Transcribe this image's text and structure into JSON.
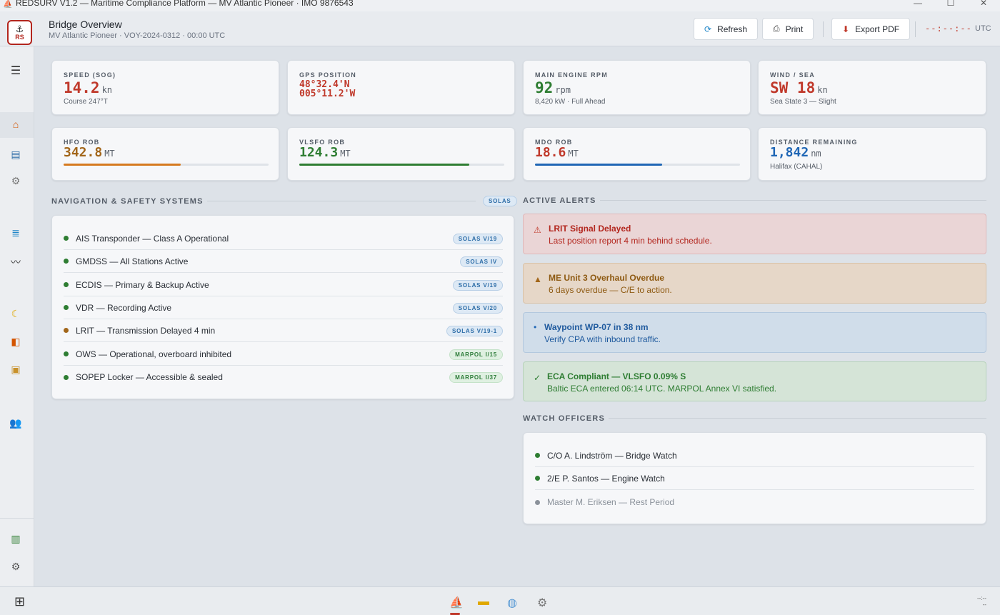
{
  "window": {
    "title": "REDSURV V1.2 — Maritime Compliance Platform — MV Atlantic Pioneer · IMO 9876543",
    "controls": [
      "—",
      "☐",
      "✕"
    ]
  },
  "header": {
    "logo_text": "RS",
    "title": "Bridge Overview",
    "subtitle": "MV Atlantic Pioneer · VOY-2024-0312 · 00:00 UTC",
    "buttons": {
      "refresh": "Refresh",
      "print": "Print",
      "export": "Export PDF"
    },
    "clock": "--:--:--",
    "timezone": "UTC"
  },
  "sidebar": {
    "icons": [
      "menu-icon",
      "home-icon",
      "book-icon",
      "settings-gear-icon",
      "database-icon",
      "wave-icon",
      "moon-icon",
      "life-vest-icon",
      "package-icon",
      "users-icon",
      "chart-icon",
      "gear-icon"
    ]
  },
  "stats": [
    {
      "label": "SPEED (SOG)",
      "value": "14.2",
      "unit": "kn",
      "sub": "Course 247°T",
      "color": "#c0392b"
    },
    {
      "label": "GPS POSITION",
      "lat": "48°32.4'N",
      "lon": "005°11.2'W",
      "color": "#c0392b"
    },
    {
      "label": "MAIN ENGINE RPM",
      "value": "92",
      "unit": "rpm",
      "sub": "8,420 kW · Full Ahead",
      "color": "#2e7d32"
    },
    {
      "label": "WIND / SEA",
      "value": "SW 18",
      "unit": "kn",
      "sub": "Sea State 3 — Slight",
      "color": "#c0392b"
    }
  ],
  "fuel": [
    {
      "label": "HFO ROB",
      "value": "342.8",
      "unit": "MT",
      "level": 0.57,
      "color": "#d67a1f",
      "text_color": "#a2661a"
    },
    {
      "label": "VLSFO ROB",
      "value": "124.3",
      "unit": "MT",
      "level": 0.83,
      "color": "#2e7d32",
      "text_color": "#2e7d32"
    },
    {
      "label": "MDO ROB",
      "value": "18.6",
      "unit": "MT",
      "level": 0.62,
      "color": "#1f66b5",
      "text_color": "#c0392b"
    },
    {
      "label": "DISTANCE REMAINING",
      "value": "1,842",
      "unit": "nm",
      "sub": "Halifax (CAHAL)",
      "text_color": "#1f66b5"
    }
  ],
  "navigation": {
    "title": "NAVIGATION & SAFETY SYSTEMS",
    "badge": "SOLAS",
    "systems": [
      {
        "label": "AIS Transponder — Class A Operational",
        "badge": "SOLAS V/19",
        "status": "ok",
        "kind": "solas"
      },
      {
        "label": "GMDSS — All Stations Active",
        "badge": "SOLAS IV",
        "status": "ok",
        "kind": "solas"
      },
      {
        "label": "ECDIS — Primary & Backup Active",
        "badge": "SOLAS V/19",
        "status": "ok",
        "kind": "solas"
      },
      {
        "label": "VDR — Recording Active",
        "badge": "SOLAS V/20",
        "status": "ok",
        "kind": "solas"
      },
      {
        "label": "LRIT — Transmission Delayed 4 min",
        "badge": "SOLAS V/19-1",
        "status": "warn",
        "kind": "solas"
      },
      {
        "label": "OWS — Operational, overboard inhibited",
        "badge": "MARPOL I/15",
        "status": "ok",
        "kind": "marpol"
      },
      {
        "label": "SOPEP Locker — Accessible & sealed",
        "badge": "MARPOL I/37",
        "status": "ok",
        "kind": "marpol"
      }
    ]
  },
  "alerts": {
    "title": "ACTIVE ALERTS",
    "items": [
      {
        "icon": "⚠",
        "title": "LRIT Signal Delayed",
        "message": "Last position report 4 min behind schedule.",
        "severity": "danger"
      },
      {
        "icon": "▲",
        "title": "ME Unit 3 Overhaul Overdue",
        "message": "6 days overdue — C/E to action.",
        "severity": "warning"
      },
      {
        "icon": "•",
        "title": "Waypoint WP-07 in 38 nm",
        "message": "Verify CPA with inbound traffic.",
        "severity": "info"
      },
      {
        "icon": "✓",
        "title": "ECA Compliant — VLSFO 0.09% S",
        "message": "Baltic ECA entered 06:14 UTC. MARPOL Annex VI satisfied.",
        "severity": "success"
      }
    ]
  },
  "officers": {
    "title": "WATCH OFFICERS",
    "items": [
      {
        "label": "C/O A. Lindström — Bridge Watch",
        "status": "on"
      },
      {
        "label": "2/E P. Santos — Engine Watch",
        "status": "on"
      },
      {
        "label": "Master M. Eriksen — Rest Period",
        "status": "off"
      }
    ]
  },
  "taskbar": {
    "clock_line1": "--:--",
    "clock_line2": "--"
  },
  "colors": {
    "ok": "#2e7d32",
    "warn": "#a2661a",
    "off": "#8a919a",
    "accent": "#c0392b"
  }
}
